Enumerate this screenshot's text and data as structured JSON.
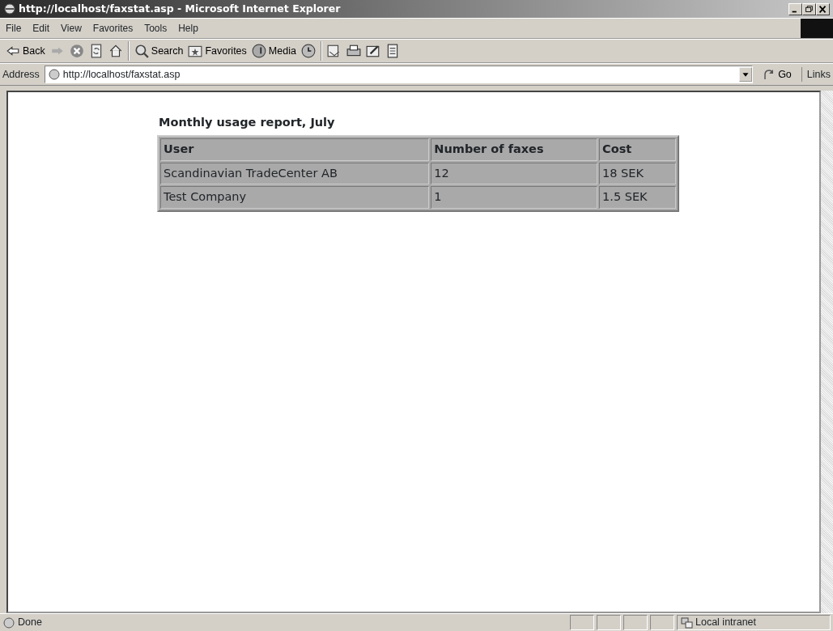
{
  "window": {
    "title": "http://localhost/faxstat.asp - Microsoft Internet Explorer"
  },
  "menu": [
    "File",
    "Edit",
    "View",
    "Favorites",
    "Tools",
    "Help"
  ],
  "toolbar": [
    {
      "kind": "back",
      "label": "Back"
    },
    {
      "kind": "forward"
    },
    {
      "kind": "stop"
    },
    {
      "kind": "refresh"
    },
    {
      "kind": "home"
    },
    {
      "kind": "sep"
    },
    {
      "kind": "search",
      "label": "Search"
    },
    {
      "kind": "favorites",
      "label": "Favorites"
    },
    {
      "kind": "media",
      "label": "Media"
    },
    {
      "kind": "history"
    },
    {
      "kind": "sep"
    },
    {
      "kind": "mail"
    },
    {
      "kind": "print"
    },
    {
      "kind": "edit"
    },
    {
      "kind": "discuss"
    }
  ],
  "address": {
    "label": "Address",
    "url": "http://localhost/faxstat.asp",
    "go": "Go",
    "links": "Links"
  },
  "report": {
    "title": "Monthly usage report, July",
    "columns": [
      "User",
      "Number of faxes",
      "Cost"
    ],
    "rows": [
      [
        "Scandinavian TradeCenter AB",
        "12",
        "18 SEK"
      ],
      [
        "Test Company",
        "1",
        "1.5 SEK"
      ]
    ]
  },
  "status_bar": {
    "text": "Done",
    "zone": "Local intranet"
  }
}
